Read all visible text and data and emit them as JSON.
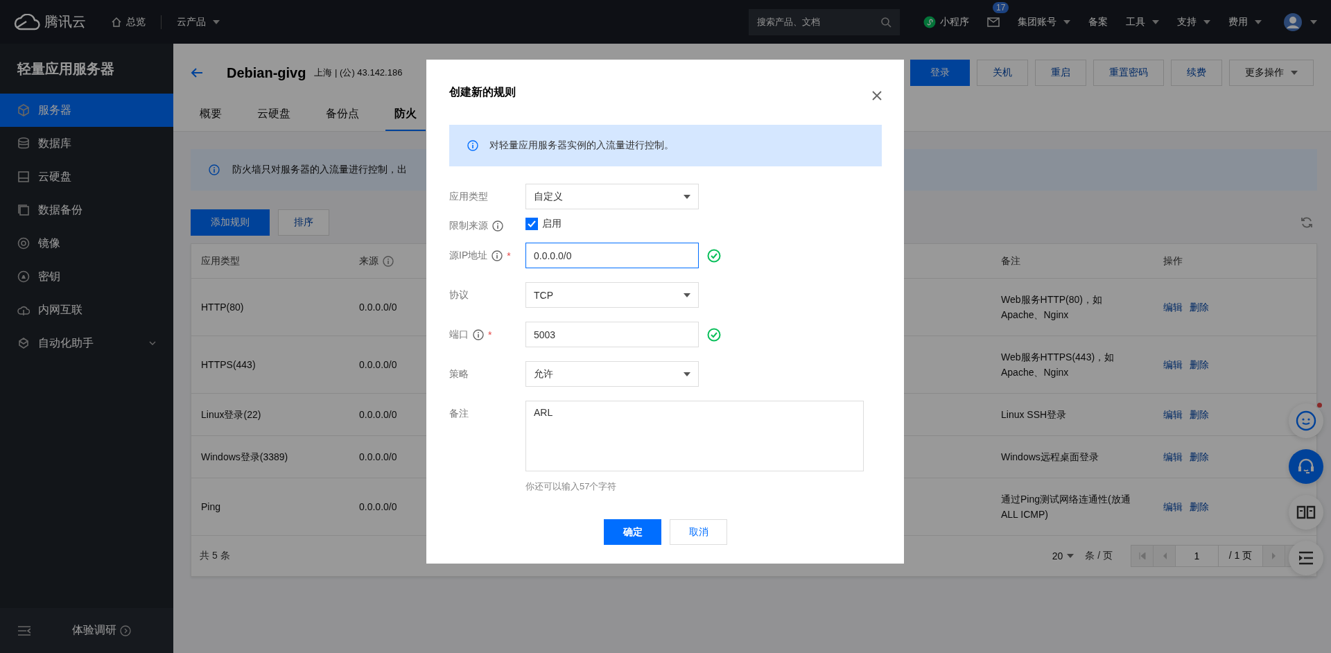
{
  "top_nav": {
    "logo": "腾讯云",
    "overview": "总览",
    "products": "云产品",
    "search": {
      "placeholder": "搜索产品、文档"
    },
    "mini_program": "小程序",
    "message_count": "17",
    "links": [
      {
        "label": "集团账号",
        "dropdown": true
      },
      {
        "label": "备案",
        "dropdown": false
      },
      {
        "label": "工具",
        "dropdown": true
      },
      {
        "label": "支持",
        "dropdown": true
      },
      {
        "label": "费用",
        "dropdown": true
      }
    ]
  },
  "sidebar": {
    "title": "轻量应用服务器",
    "items": [
      {
        "label": "服务器",
        "selected": true,
        "expandable": false
      },
      {
        "label": "数据库",
        "selected": false,
        "expandable": false
      },
      {
        "label": "云硬盘",
        "selected": false,
        "expandable": false
      },
      {
        "label": "数据备份",
        "selected": false,
        "expandable": false
      },
      {
        "label": "镜像",
        "selected": false,
        "expandable": false
      },
      {
        "label": "密钥",
        "selected": false,
        "expandable": false
      },
      {
        "label": "内网互联",
        "selected": false,
        "expandable": false
      },
      {
        "label": "自动化助手",
        "selected": false,
        "expandable": true
      }
    ],
    "survey": "体验调研"
  },
  "header": {
    "title": "Debian-givg",
    "region": "上海 | (公) 43.142.186",
    "actions": [
      {
        "label": "登录",
        "primary": true
      },
      {
        "label": "关机",
        "primary": false
      },
      {
        "label": "重启",
        "primary": false
      },
      {
        "label": "重置密码",
        "primary": false
      },
      {
        "label": "续费",
        "primary": false
      }
    ],
    "more": "更多操作"
  },
  "tabs": [
    {
      "label": "概要",
      "selected": false
    },
    {
      "label": "云硬盘",
      "selected": false
    },
    {
      "label": "备份点",
      "selected": false
    },
    {
      "label": "防火",
      "selected": true
    }
  ],
  "notice": "防火墙只对服务器的入流量进行控制，出",
  "toolbar": {
    "add": "添加规则",
    "sort": "排序"
  },
  "table": {
    "columns": [
      {
        "label": "应用类型"
      },
      {
        "label": "来源",
        "info": true
      },
      {
        "label": "备注"
      },
      {
        "label": "操作"
      }
    ],
    "rows": [
      {
        "app_type": "HTTP(80)",
        "source": "0.0.0.0/0",
        "note": "Web服务HTTP(80)，如Apache、Nginx",
        "actions": [
          "编辑",
          "删除"
        ]
      },
      {
        "app_type": "HTTPS(443)",
        "source": "0.0.0.0/0",
        "note": "Web服务HTTPS(443)，如Apache、Nginx",
        "actions": [
          "编辑",
          "删除"
        ]
      },
      {
        "app_type": "Linux登录(22)",
        "source": "0.0.0.0/0",
        "note": "Linux SSH登录",
        "actions": [
          "编辑",
          "删除"
        ]
      },
      {
        "app_type": "Windows登录(3389)",
        "source": "0.0.0.0/0",
        "note": "Windows远程桌面登录",
        "actions": [
          "编辑",
          "删除"
        ]
      },
      {
        "app_type": "Ping",
        "source": "0.0.0.0/0",
        "note": "通过Ping测试网络连通性(放通ALL ICMP)",
        "actions": [
          "编辑",
          "删除"
        ]
      }
    ]
  },
  "pagination": {
    "total": "共 5 条",
    "page_size": "20",
    "per_page": "条 / 页",
    "page": "1",
    "pages": "/ 1 页"
  },
  "dialog": {
    "title": "创建新的规则",
    "notice": "对轻量应用服务器实例的入流量进行控制。",
    "fields": [
      {
        "kind": "select",
        "label": "应用类型",
        "value": "自定义",
        "focused": false,
        "valid": false
      },
      {
        "kind": "checkbox",
        "label": "限制来源",
        "info": true,
        "option": "启用",
        "checked": true
      },
      {
        "kind": "input",
        "label": "源IP地址",
        "info": true,
        "required_mark": "*",
        "value": "0.0.0.0/0",
        "focused": true,
        "valid": true
      },
      {
        "kind": "select",
        "label": "协议",
        "value": "TCP",
        "focused": false,
        "valid": false
      },
      {
        "kind": "input",
        "label": "端口",
        "info": true,
        "required_mark": "*",
        "value": "5003",
        "focused": false,
        "valid": true
      },
      {
        "kind": "select",
        "label": "策略",
        "value": "允许",
        "focused": false,
        "valid": false
      },
      {
        "kind": "textarea",
        "label": "备注",
        "value": "ARL",
        "hint": "你还可以输入57个字符"
      }
    ],
    "buttons": [
      {
        "label": "确定",
        "primary": true
      },
      {
        "label": "取消",
        "primary": false
      }
    ]
  }
}
